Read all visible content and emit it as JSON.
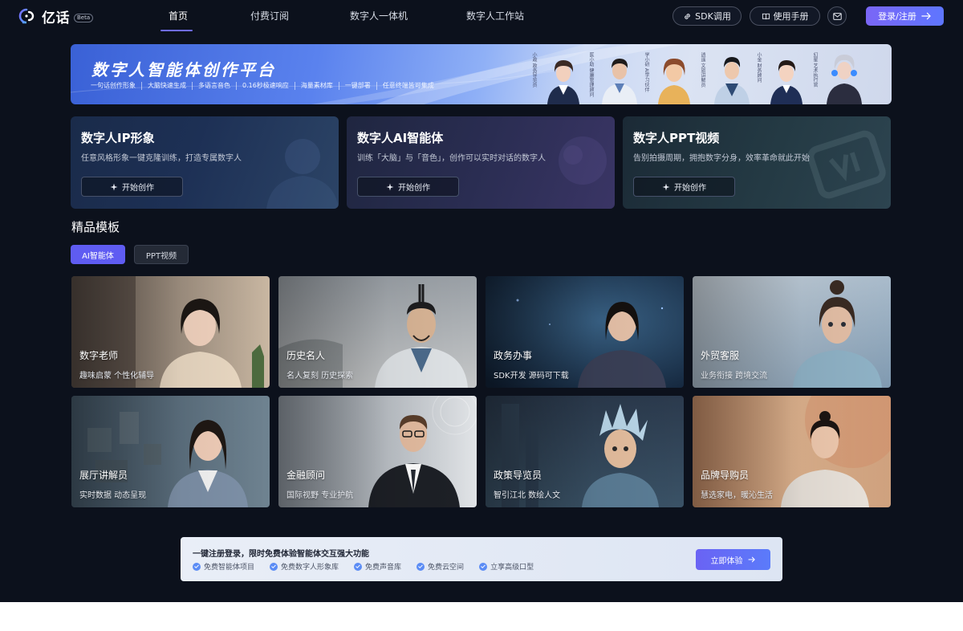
{
  "brand": {
    "name": "亿话",
    "badge": "Beta",
    "logo_icon": "speech-bubble-logo-icon"
  },
  "nav": {
    "items": [
      {
        "label": "首页",
        "active": true
      },
      {
        "label": "付费订阅",
        "active": false
      },
      {
        "label": "数字人一体机",
        "active": false
      },
      {
        "label": "数字人工作站",
        "active": false
      }
    ],
    "sdk_label": "SDK调用",
    "manual_label": "使用手册",
    "mail_icon": "mail-icon",
    "login_label": "登录/注册",
    "accent": "#6f6cf7"
  },
  "banner": {
    "title": "数字人智能体创作平台",
    "tags": [
      "一句话创作形象",
      "大脑快速生成",
      "多语言音色",
      "0.16秒极速响应",
      "海量素材库",
      "一键部署",
      "任意终端皆可集成"
    ],
    "avatar_captions": [
      "小政 政务导览员",
      "医小助 健康管理顾问",
      "学小研 AI学习伙伴",
      "逍遥 文旅讲解员",
      "小金 财务顾问",
      "幻星 艺术执行官"
    ]
  },
  "features": [
    {
      "title": "数字人IP形象",
      "desc": "任意风格形象一键克隆训练，打造专属数字人",
      "button": "开始创作"
    },
    {
      "title": "数字人AI智能体",
      "desc": "训练「大脑」与「音色」，创作可以实时对话的数字人",
      "button": "开始创作"
    },
    {
      "title": "数字人PPT视频",
      "desc": "告别拍摄周期，拥抱数字分身，效率革命就此开始",
      "button": "开始创作"
    }
  ],
  "templates": {
    "section_title": "精品模板",
    "tabs": [
      {
        "label": "AI智能体",
        "active": true
      },
      {
        "label": "PPT视频",
        "active": false
      }
    ],
    "cards": [
      {
        "name": "数字老师",
        "sub": "趣味启蒙 个性化辅导"
      },
      {
        "name": "历史名人",
        "sub": "名人复刻 历史探索"
      },
      {
        "name": "政务办事",
        "sub": "SDK开发 源码可下载"
      },
      {
        "name": "外贸客服",
        "sub": "业务衔接 跨境交流"
      },
      {
        "name": "展厅讲解员",
        "sub": "实时数据 动态呈现"
      },
      {
        "name": "金融顾问",
        "sub": "国际视野 专业护航"
      },
      {
        "name": "政策导览员",
        "sub": "智引江北 数绘人文"
      },
      {
        "name": "品牌导购员",
        "sub": "慧选家电，暖沁生活"
      }
    ]
  },
  "promo": {
    "title": "一键注册登录，限时免费体验智能体交互强大功能",
    "features": [
      "免费智能体项目",
      "免费数字人形象库",
      "免费声音库",
      "免费云空间",
      "立享高级口型"
    ],
    "button": "立即体验",
    "check_color": "#5b8cf5"
  }
}
